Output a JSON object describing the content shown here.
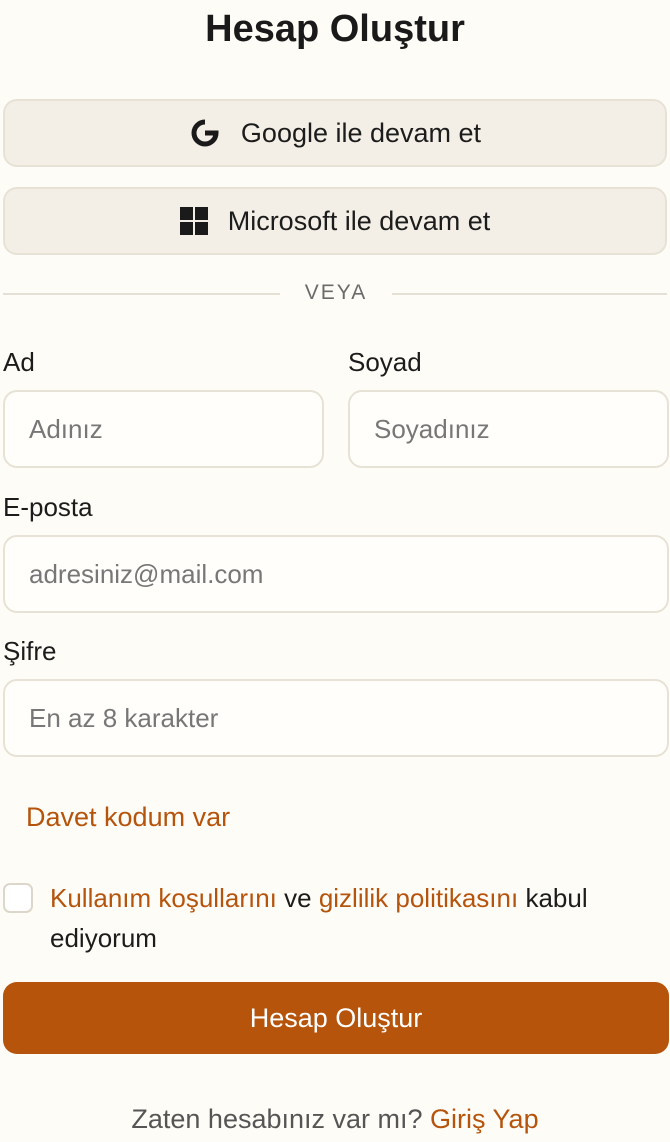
{
  "page": {
    "title": "Hesap Oluştur"
  },
  "social": {
    "google_label": "Google ile devam et",
    "google_icon": "google-icon",
    "microsoft_label": "Microsoft ile devam et",
    "microsoft_icon": "microsoft-icon"
  },
  "divider": {
    "text": "VEYA"
  },
  "form": {
    "first_name_label": "Ad",
    "first_name_placeholder": "Adınız",
    "last_name_label": "Soyad",
    "last_name_placeholder": "Soyadınız",
    "email_label": "E-posta",
    "email_placeholder": "adresiniz@mail.com",
    "password_label": "Şifre",
    "password_placeholder": "En az 8 karakter",
    "invite_link": "Davet kodum var",
    "terms_link": "Kullanım koşullarını",
    "terms_and": " ve ",
    "privacy_link": "gizlilik politikasını",
    "terms_suffix": " kabul ediyorum",
    "submit_label": "Hesap Oluştur"
  },
  "footer": {
    "question": "Zaten hesabınız var mı? ",
    "login_link": "Giriş Yap"
  },
  "colors": {
    "accent": "#b5540a",
    "background": "#fefcf6",
    "social_button_bg": "#f4efe6",
    "border": "#e7e2d6"
  }
}
